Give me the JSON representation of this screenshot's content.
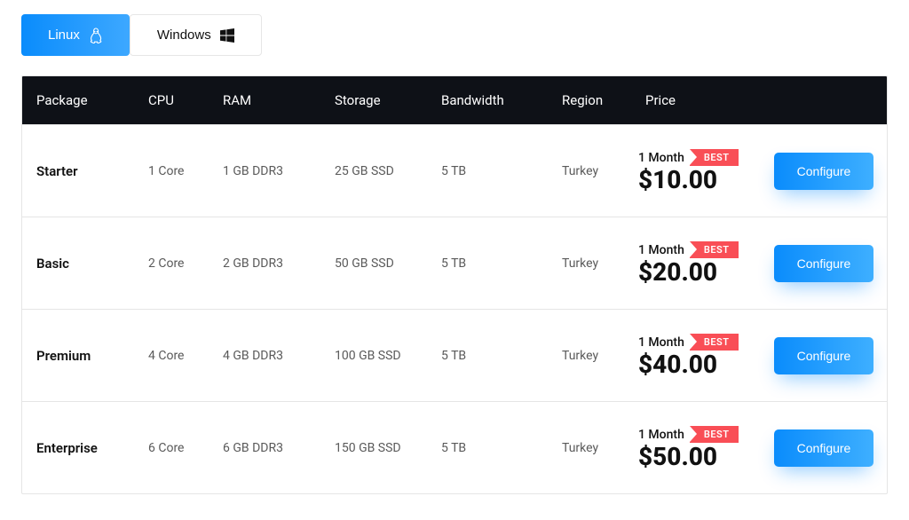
{
  "tabs": {
    "linux": "Linux",
    "windows": "Windows"
  },
  "headers": {
    "package": "Package",
    "cpu": "CPU",
    "ram": "RAM",
    "storage": "Storage",
    "bandwidth": "Bandwidth",
    "region": "Region",
    "price": "Price"
  },
  "badge": "BEST",
  "period": "1 Month",
  "configure": "Configure",
  "rows": [
    {
      "package": "Starter",
      "cpu": "1 Core",
      "ram": "1 GB DDR3",
      "storage": "25 GB SSD",
      "bandwidth": "5 TB",
      "region": "Turkey",
      "price": "$10.00"
    },
    {
      "package": "Basic",
      "cpu": "2 Core",
      "ram": "2 GB DDR3",
      "storage": "50 GB SSD",
      "bandwidth": "5 TB",
      "region": "Turkey",
      "price": "$20.00"
    },
    {
      "package": "Premium",
      "cpu": "4 Core",
      "ram": "4 GB DDR3",
      "storage": "100 GB SSD",
      "bandwidth": "5 TB",
      "region": "Turkey",
      "price": "$40.00"
    },
    {
      "package": "Enterprise",
      "cpu": "6 Core",
      "ram": "6 GB DDR3",
      "storage": "150 GB SSD",
      "bandwidth": "5 TB",
      "region": "Turkey",
      "price": "$50.00"
    }
  ]
}
